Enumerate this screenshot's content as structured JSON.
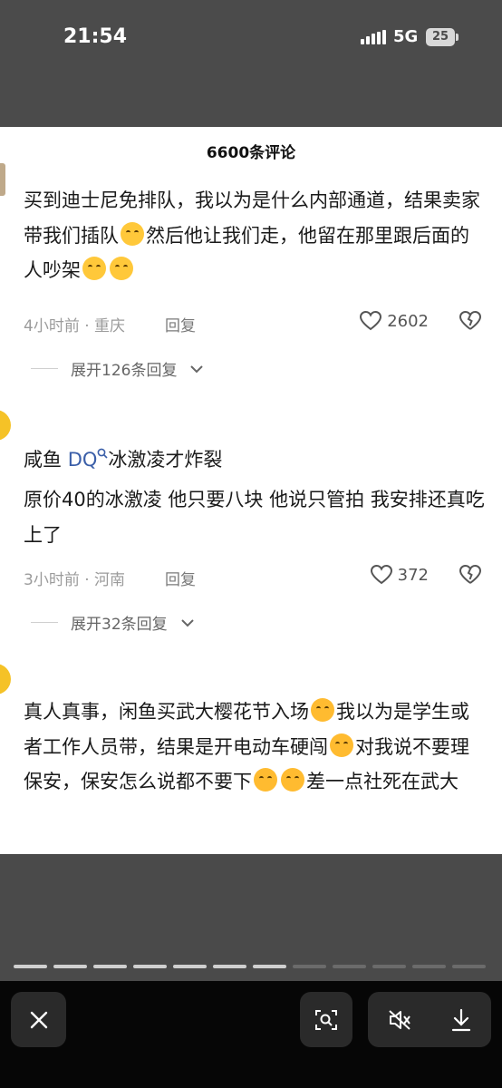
{
  "status_bar": {
    "time": "21:54",
    "network": "5G",
    "battery": "25"
  },
  "sheet": {
    "title": "6600条评论"
  },
  "comments": [
    {
      "text_parts": [
        "买到迪士尼免排队，我以为是什么内部通道，结果卖家带我们插队",
        "然后他让我们走，他留在那里跟后面的人吵架"
      ],
      "emoji_names": [
        "grin-sweat-emoji",
        "grin-sweat-emoji",
        "grin-sweat-emoji"
      ],
      "time_location": "4小时前 · 重庆",
      "reply_label": "回复",
      "likes": "2602",
      "expand_label": "展开126条回复"
    },
    {
      "username": "咸鱼",
      "tag": "DQ",
      "search_hint": "冰激凌才炸裂",
      "text": "原价40的冰激凌 他只要八块 他说只管拍 我安排还真吃上了",
      "time_location": "3小时前 · 河南",
      "reply_label": "回复",
      "likes": "372",
      "expand_label": "展开32条回复"
    },
    {
      "text_parts": [
        "真人真事，闲鱼买武大樱花节入场",
        "我以为是学生或者工作人员带，结果是开电动车硬闯",
        "对我说不要理保安，保安怎么说都不要下",
        "差一点社死在武大"
      ],
      "emoji_names": [
        "loudly-crying-emoji",
        "crying-laughing-emoji",
        "crying-laughing-emoji",
        "crying-laughing-emoji"
      ]
    }
  ],
  "colors": {
    "accent_link": "#3a5ea8",
    "meta_gray": "#9b9b9b",
    "overlay": "#4a4a4a"
  }
}
